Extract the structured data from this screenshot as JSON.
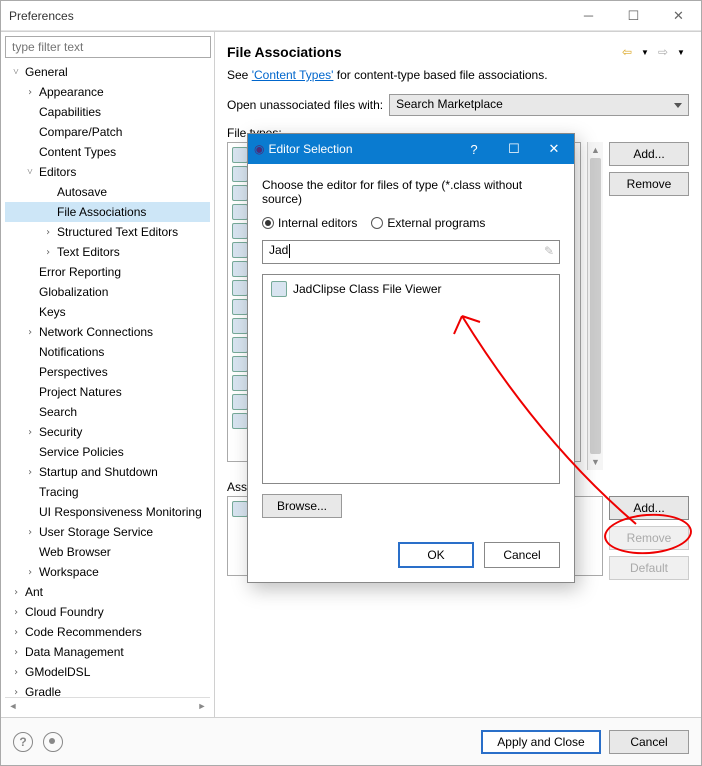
{
  "window": {
    "title": "Preferences"
  },
  "filter_placeholder": "type filter text",
  "tree": {
    "general": "General",
    "appearance": "Appearance",
    "capabilities": "Capabilities",
    "compare": "Compare/Patch",
    "content_types": "Content Types",
    "editors": "Editors",
    "autosave": "Autosave",
    "file_assoc": "File Associations",
    "structured": "Structured Text Editors",
    "text_editors": "Text Editors",
    "error_reporting": "Error Reporting",
    "globalization": "Globalization",
    "keys": "Keys",
    "network": "Network Connections",
    "notifications": "Notifications",
    "perspectives": "Perspectives",
    "project_natures": "Project Natures",
    "search": "Search",
    "security": "Security",
    "service_policies": "Service Policies",
    "startup": "Startup and Shutdown",
    "tracing": "Tracing",
    "ui_resp": "UI Responsiveness Monitoring",
    "user_storage": "User Storage Service",
    "web_browser": "Web Browser",
    "workspace": "Workspace",
    "ant": "Ant",
    "cloud_foundry": "Cloud Foundry",
    "code_recommenders": "Code Recommenders",
    "data_management": "Data Management",
    "gmodeldsl": "GModelDSL",
    "gradle": "Gradle"
  },
  "main": {
    "title": "File Associations",
    "desc_prefix": "See ",
    "desc_link": "'Content Types'",
    "desc_suffix": " for content-type based file associations.",
    "open_label": "Open unassociated files with:",
    "open_value": "Search Marketplace",
    "file_types_label": "File types:",
    "assoc_label": "Associated editors:",
    "add": "Add...",
    "remove": "Remove",
    "default": "Default"
  },
  "footer": {
    "apply": "Apply and Close",
    "cancel": "Cancel"
  },
  "modal": {
    "title": "Editor Selection",
    "instruction": "Choose the editor for files of type (*.class without source)",
    "internal": "Internal editors",
    "external": "External programs",
    "input_value": "Jad",
    "result": "JadClipse Class File Viewer",
    "browse": "Browse...",
    "ok": "OK",
    "cancel": "Cancel"
  }
}
